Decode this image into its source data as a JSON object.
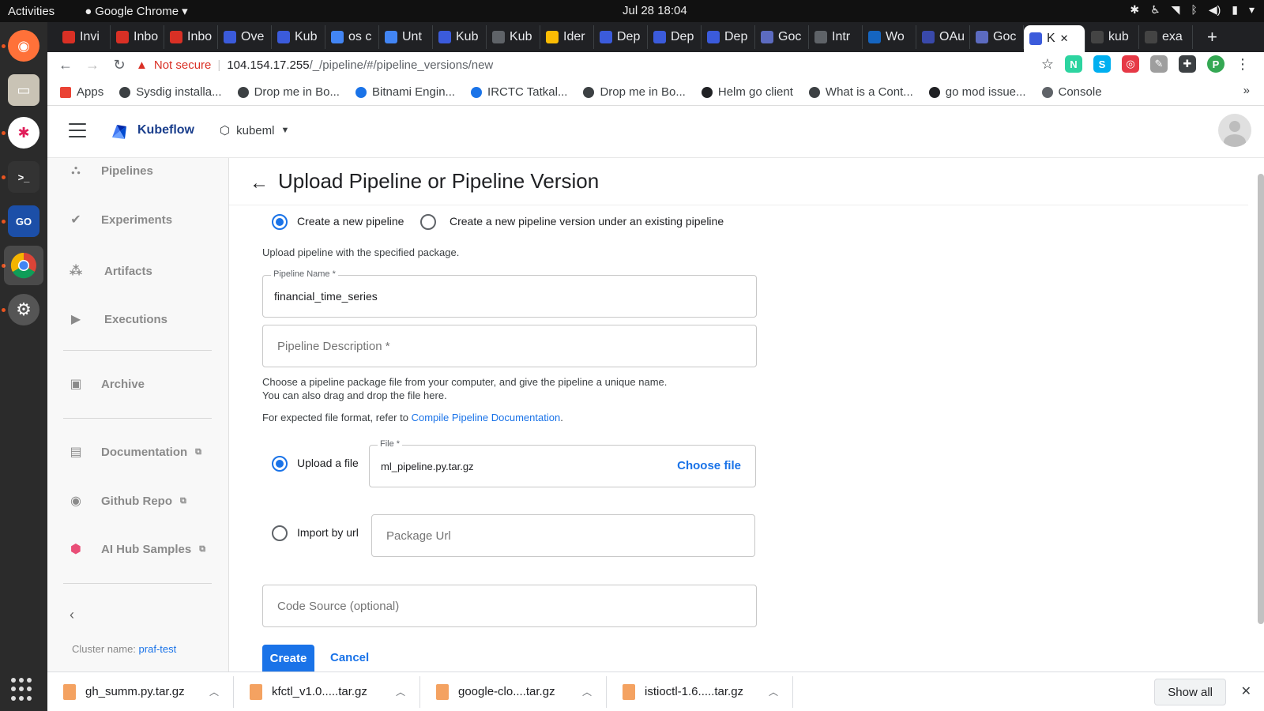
{
  "os": {
    "activities": "Activities",
    "app_name": "Google Chrome",
    "clock": "Jul 28  18:04"
  },
  "browser": {
    "tabs": [
      {
        "label": "Invi",
        "color": "#d93025"
      },
      {
        "label": "Inbo",
        "color": "#d93025"
      },
      {
        "label": "Inbo",
        "color": "#d93025"
      },
      {
        "label": "Ove",
        "color": "#3b5bdb"
      },
      {
        "label": "Kub",
        "color": "#3b5bdb"
      },
      {
        "label": "os c",
        "color": "#4285f4"
      },
      {
        "label": "Unt",
        "color": "#4285f4"
      },
      {
        "label": "Kub",
        "color": "#3b5bdb"
      },
      {
        "label": "Kub",
        "color": "#5f6368"
      },
      {
        "label": "Ider",
        "color": "#fbbc04"
      },
      {
        "label": "Dep",
        "color": "#3b5bdb"
      },
      {
        "label": "Dep",
        "color": "#3b5bdb"
      },
      {
        "label": "Dep",
        "color": "#3b5bdb"
      },
      {
        "label": "Goc",
        "color": "#5c6bc0"
      },
      {
        "label": "Intr",
        "color": "#5f6368"
      },
      {
        "label": "Wo",
        "color": "#1565c0"
      },
      {
        "label": "OAu",
        "color": "#3949ab"
      },
      {
        "label": "Goc",
        "color": "#5c6bc0"
      },
      {
        "label": "K",
        "color": "#3b5bdb",
        "active": true
      },
      {
        "label": "kub",
        "color": "#444"
      },
      {
        "label": "exa",
        "color": "#444"
      }
    ],
    "new_tab": "+",
    "not_secure": "Not secure",
    "url_host": "104.154.17.255",
    "url_path": "/_/pipeline/#/pipeline_versions/new",
    "extensions": [
      {
        "name": "n-extension-icon",
        "label": "N",
        "color": "#2dd4a0"
      },
      {
        "name": "skype-icon",
        "label": "S",
        "color": "#00aff0"
      },
      {
        "name": "extension-red-icon",
        "label": "◎",
        "color": "#e63946"
      },
      {
        "name": "edit-extension-icon",
        "label": "✎",
        "color": "#9e9e9e"
      },
      {
        "name": "puzzle-icon",
        "label": "✚",
        "color": "#3c4043"
      },
      {
        "name": "profile-icon",
        "label": "P",
        "color": "#34a853"
      }
    ],
    "bookmarks": [
      "Apps",
      "Sysdig installa...",
      "Drop me in Bo...",
      "Bitnami Engin...",
      "IRCTC Tatkal...",
      "Drop me in Bo...",
      "Helm go client",
      "What is a Cont...",
      "go mod issue...",
      "Console"
    ],
    "bookmarks_more": "»"
  },
  "kubeflow": {
    "title": "Kubeflow",
    "namespace": "kubeml"
  },
  "sidebar": {
    "items": [
      {
        "label": "Pipelines",
        "icon": "⛬"
      },
      {
        "label": "Experiments",
        "icon": "✔"
      },
      {
        "label": "Artifacts",
        "icon": "⁂"
      },
      {
        "label": "Executions",
        "icon": "▶"
      },
      {
        "label": "Archive",
        "icon": "▣"
      },
      {
        "label": "Documentation",
        "icon": "▤"
      },
      {
        "label": "Github Repo",
        "icon": "◉"
      },
      {
        "label": "AI Hub Samples",
        "icon": "⬢"
      }
    ],
    "external_mark": "⧉",
    "collapse": "‹",
    "cluster_label": "Cluster name:",
    "cluster_value": "praf-test"
  },
  "page": {
    "title": "Upload Pipeline or Pipeline Version",
    "mode_new": "Create a new pipeline",
    "mode_version": "Create a new pipeline version under an existing pipeline",
    "upload_hint": "Upload pipeline with the specified package.",
    "name_label": "Pipeline Name *",
    "name_value": "financial_time_series",
    "description_placeholder": "Pipeline Description *",
    "help_line1": "Choose a pipeline package file from your computer, and give the pipeline a unique name.",
    "help_line2": "You can also drag and drop the file here.",
    "help_format": "For expected file format, refer to",
    "help_link": "Compile Pipeline Documentation",
    "help_period": ".",
    "upload_option": "Upload a file",
    "file_label": "File *",
    "file_value": "ml_pipeline.py.tar.gz",
    "choose_file": "Choose file",
    "url_option": "Import by url",
    "url_placeholder": "Package Url",
    "code_source_placeholder": "Code Source (optional)",
    "create": "Create",
    "cancel": "Cancel"
  },
  "downloads": {
    "items": [
      "gh_summ.py.tar.gz",
      "kfctl_v1.0.....tar.gz",
      "google-clo....tar.gz",
      "istioctl-1.6.....tar.gz"
    ],
    "show_all": "Show all",
    "close": "✕"
  }
}
